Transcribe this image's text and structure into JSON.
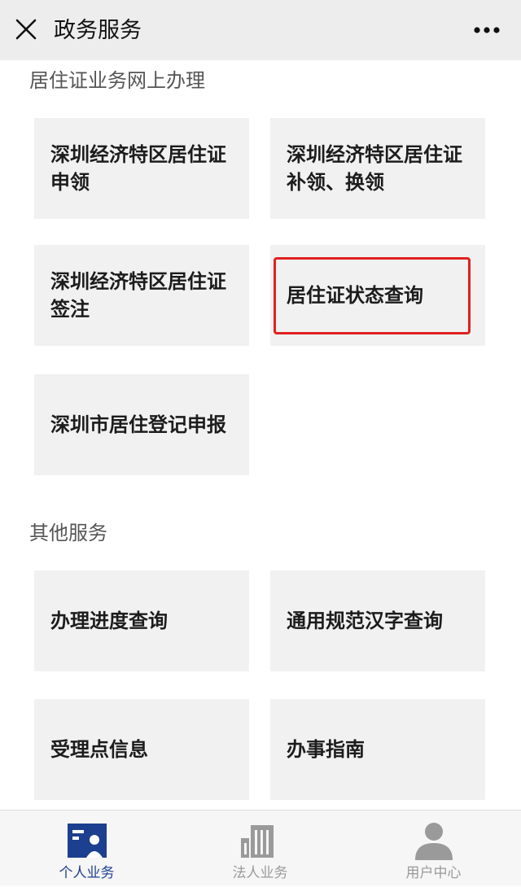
{
  "header": {
    "title": "政务服务",
    "close_icon": "close-icon",
    "more_icon": "more-horizontal-icon"
  },
  "sections": [
    {
      "title": "居住证业务网上办理",
      "items": [
        {
          "label": "深圳经济特区居住证\n申领"
        },
        {
          "label": "深圳经济特区居住证\n补领、换领"
        },
        {
          "label": "深圳经济特区居住证\n签注"
        },
        {
          "label": "居住证状态查询",
          "highlighted": true
        },
        {
          "label": "深圳市居住登记申报"
        }
      ]
    },
    {
      "title": "其他服务",
      "items": [
        {
          "label": "办理进度查询"
        },
        {
          "label": "通用规范汉字查询"
        },
        {
          "label": "受理点信息"
        },
        {
          "label": "办事指南"
        }
      ]
    }
  ],
  "tabbar": {
    "tabs": [
      {
        "label": "个人业务",
        "icon": "id-card-icon",
        "active": true
      },
      {
        "label": "法人业务",
        "icon": "building-icon",
        "active": false
      },
      {
        "label": "用户中心",
        "icon": "user-icon",
        "active": false
      }
    ]
  },
  "colors": {
    "accent": "#1d3f8f",
    "inactive": "#9a9a9a",
    "highlight_border": "#e0211f",
    "card_bg": "#f1f1f1",
    "header_bg": "#ededed"
  }
}
